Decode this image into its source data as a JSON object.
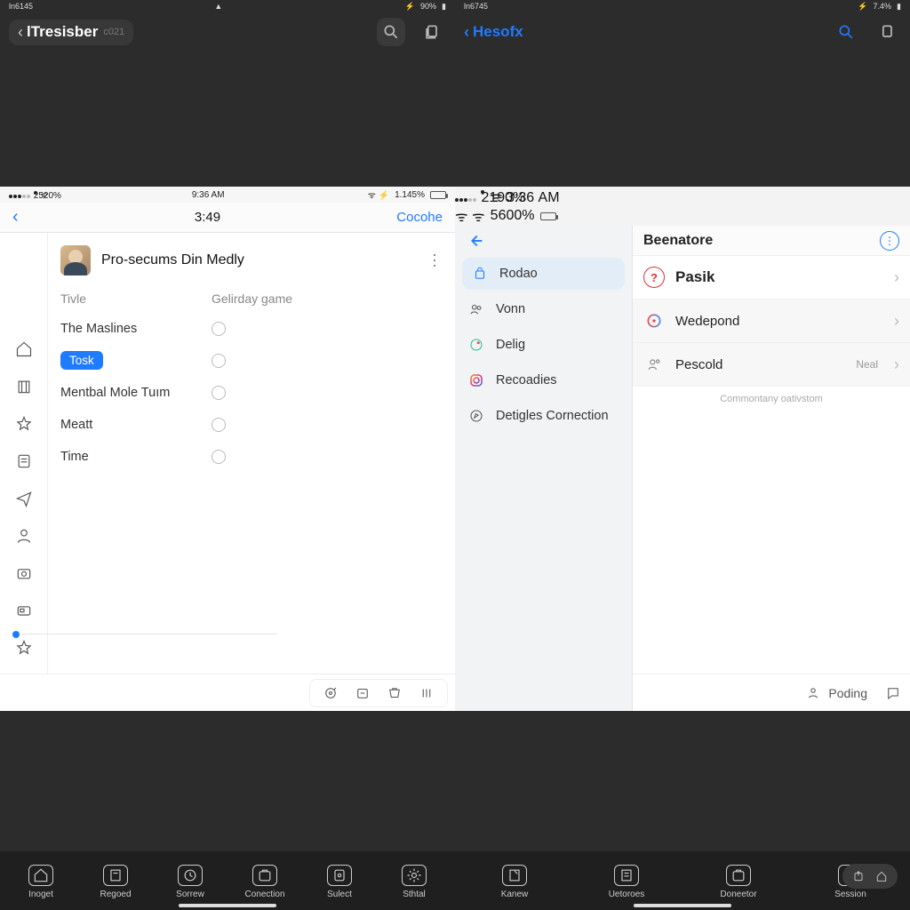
{
  "left": {
    "device_status": {
      "time": "ln6145",
      "battery": "90%"
    },
    "header": {
      "title": "lTresisber",
      "subtitle": "c021"
    },
    "inner_status": {
      "pct": "2520%",
      "clock": "9:36 AM",
      "net": "1.145%"
    },
    "nav": {
      "center": "3:49",
      "right": "Cocohe"
    },
    "person": "Pro-secums Din Medly",
    "headers": {
      "a": "Tivle",
      "b": "Gelirday game"
    },
    "rows": [
      {
        "label": "The Maslines",
        "chip": false
      },
      {
        "label": "Tosk",
        "chip": true
      },
      {
        "label": "Mentbal Mole Tuım",
        "chip": false
      },
      {
        "label": "Meatt",
        "chip": false
      },
      {
        "label": "Time",
        "chip": false
      }
    ],
    "tabs": [
      "Inoget",
      "Regoed",
      "Sorrew",
      "Conection",
      "Sulect",
      "Sthtal"
    ]
  },
  "right": {
    "device_status": {
      "time": "ln6745",
      "battery": "7.4%"
    },
    "header": {
      "title": "Hesofx"
    },
    "inner_status": {
      "pct": "2190%",
      "clock": "3:36 AM",
      "net": "5600%"
    },
    "detail_title": "Beenatore",
    "menu": [
      {
        "label": "Rodao",
        "active": true
      },
      {
        "label": "Vonn"
      },
      {
        "label": "Delig"
      },
      {
        "label": "Recoadies"
      },
      {
        "label": "Detigles Cornection"
      }
    ],
    "details": [
      {
        "label": "Pasik",
        "big": true
      },
      {
        "label": "Wedepond",
        "sub": true
      },
      {
        "label": "Pescold",
        "sub": true,
        "badge": "Neal"
      }
    ],
    "caption": "Commontany oativstom",
    "footer_label": "Poding",
    "tabs": [
      "Kanew",
      "Uetoroes",
      "Doneetor",
      "Session"
    ]
  }
}
